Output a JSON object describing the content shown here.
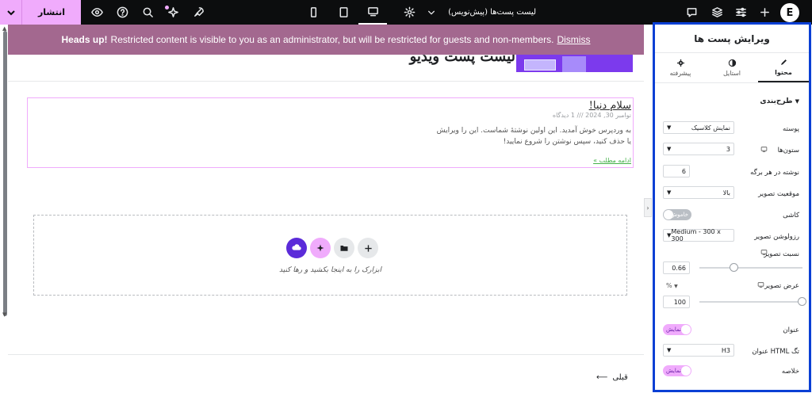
{
  "topbar": {
    "publish_label": "انتشار",
    "document_title": "لیست پست‌ها (پیش‌نویس)",
    "logo_letter": "E"
  },
  "canvas": {
    "banner": {
      "strong": "Heads up!",
      "text": "Restricted content is visible to you as an administrator, but will be restricted for guests and non-members.",
      "dismiss": "Dismiss"
    },
    "site_heading": "لیست پست ویدیو",
    "post": {
      "title": "سلام دنیا!",
      "meta": "نوامبر 30, 2024 /// 1 دیدگاه",
      "excerpt_line1": "به وردپرس خوش آمدید. این اولین نوشتهٔ شماست. این را ویرایش",
      "excerpt_line2": "یا حذف کنید، سپس نوشتن را شروع نمایید!",
      "read_more": "ادامه مطلب »"
    },
    "drop_zone_label": "ابزارک را به اینجا بکشید و رها کنید",
    "prev_link": "قبلی"
  },
  "panel": {
    "title": "ویرایش پست ها",
    "tabs": [
      {
        "label": "محتوا",
        "icon": "pencil-icon",
        "active": true
      },
      {
        "label": "استایل",
        "icon": "contrast-icon",
        "active": false
      },
      {
        "label": "پیشرفته",
        "icon": "gear-icon",
        "active": false
      }
    ],
    "section_label": "طرح‌بندی",
    "fields": {
      "skin_label": "پوسته",
      "skin_value": "نمایش کلاسیک",
      "columns_label": "ستون‌ها",
      "columns_value": "3",
      "per_page_label": "نوشته در هر برگه",
      "per_page_value": "6",
      "image_position_label": "موقعیت تصویر",
      "image_position_value": "بالا",
      "masonry_label": "کاشی",
      "masonry_value": "خاموش",
      "resolution_label": "رزولوشن تصویر",
      "resolution_value": "Medium - 300 x 300",
      "ratio_label": "نسبت تصویر",
      "ratio_value": "0.66",
      "width_label": "عرض تصویر",
      "width_unit": "%",
      "width_value": "100",
      "title_toggle_label": "عنوان",
      "title_toggle_value": "نمایش",
      "title_tag_label": "تگ HTML عنوان",
      "title_tag_value": "H3",
      "excerpt_label": "خلاصه",
      "excerpt_value": "نمایش"
    },
    "slider_levels": {
      "ratio_fraction": 0.66,
      "width_percent": 100
    }
  },
  "colors": {
    "topbar": "#0c0d0e",
    "accent_pink": "#f0abfc",
    "banner": "#a3688f",
    "panel_highlight": "#0a3fd4"
  }
}
